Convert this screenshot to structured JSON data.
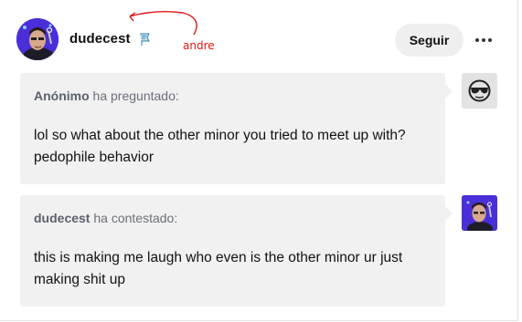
{
  "post": {
    "username": "dudecest",
    "follow_label": "Seguir",
    "annotation": "andre"
  },
  "ask": {
    "asker": "Anónimo",
    "verb": "ha preguntado:",
    "text": "lol so what about the other minor you tried to meet up with? pedophile behavior"
  },
  "answer": {
    "answerer": "dudecest",
    "verb": "ha contestado:",
    "text": "this is making me laugh who even is the other minor ur just making shit up"
  },
  "icons": {
    "more": "more-options-icon",
    "badge": "flag-badge-icon",
    "anon_avatar": "sunglasses-face-icon"
  },
  "colors": {
    "annotation": "#e01818",
    "avatar_bg": "#4a2fd8",
    "bubble_bg": "#f1f1f2"
  }
}
